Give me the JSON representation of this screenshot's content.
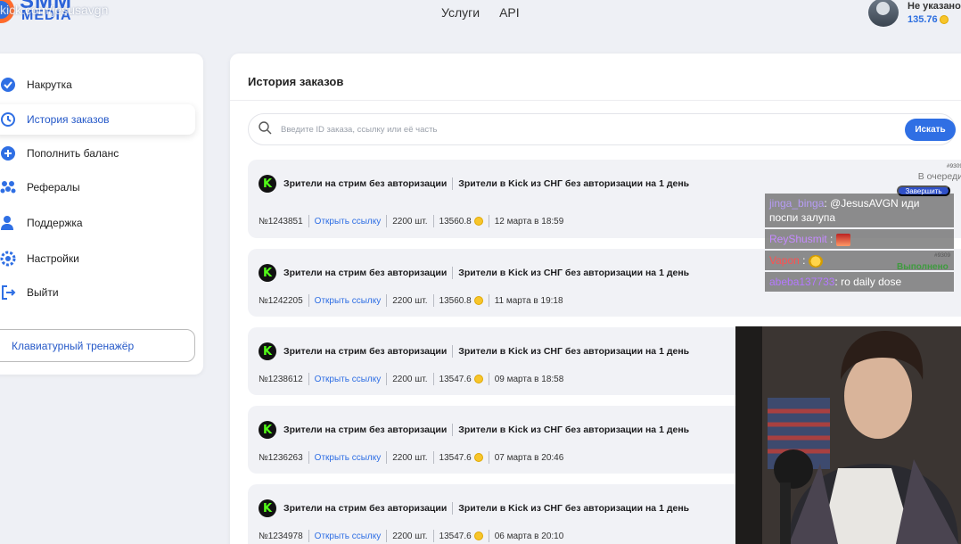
{
  "stream_overlay_title": "kick.com/jesusavgn",
  "brand": {
    "line1": "SMM",
    "line2": "MEDIA"
  },
  "topnav": [
    {
      "label": "Услуги"
    },
    {
      "label": "API"
    }
  ],
  "user": {
    "name": "Не указано",
    "balance": "135.76"
  },
  "sidebar": {
    "items": [
      {
        "label": "Накрутка",
        "icon": "check-badge-icon"
      },
      {
        "label": "История заказов",
        "icon": "history-icon",
        "active": true
      },
      {
        "label": "Пополнить баланс",
        "icon": "plus-circle-icon"
      },
      {
        "label": "Рефералы",
        "icon": "group-icon"
      },
      {
        "label": "Поддержка",
        "icon": "support-icon"
      },
      {
        "label": "Настройки",
        "icon": "gear-icon"
      },
      {
        "label": "Выйти",
        "icon": "logout-icon"
      }
    ],
    "trainer_label": "Клавиатурный тренажёр"
  },
  "main": {
    "title": "История заказов",
    "search": {
      "placeholder": "Введите ID заказа, ссылку или её часть",
      "button": "Искать"
    },
    "orders": [
      {
        "service": "Зрители на стрим без авторизации",
        "detail": "Зрители в Kick из СНГ без авторизации на 1 день",
        "id": "№1243851",
        "link": "Открыть ссылку",
        "qty": "2200 шт.",
        "price": "13560.8",
        "date": "12 марта в 18:59",
        "num": "#9309",
        "status": "В очереди"
      },
      {
        "service": "Зрители на стрим без авторизации",
        "detail": "Зрители в Kick из СНГ без авторизации на 1 день",
        "id": "№1242205",
        "link": "Открыть ссылку",
        "qty": "2200 шт.",
        "price": "13560.8",
        "date": "11 марта в 19:18"
      },
      {
        "service": "Зрители на стрим без авторизации",
        "detail": "Зрители в Kick из СНГ без авторизации на 1 день",
        "id": "№1238612",
        "link": "Открыть ссылку",
        "qty": "2200 шт.",
        "price": "13547.6",
        "date": "09 марта в 18:58"
      },
      {
        "service": "Зрители на стрим без авторизации",
        "detail": "Зрители в Kick из СНГ без авторизации на 1 день",
        "id": "№1236263",
        "link": "Открыть ссылку",
        "qty": "2200 шт.",
        "price": "13547.6",
        "date": "07 марта в 20:46"
      },
      {
        "service": "Зрители на стрим без авторизации",
        "detail": "Зрители в Kick из СНГ без авторизации на 1 день",
        "id": "№1234978",
        "link": "Открыть ссылку",
        "qty": "2200 шт.",
        "price": "13547.6",
        "date": "06 марта в 20:10"
      }
    ]
  },
  "overlay": {
    "end_button": "Завершить",
    "second_num": "#9309",
    "done_status": "Выполнено",
    "chat": [
      {
        "user": "jinga_binga",
        "text": ": @JesusAVGN иди поспи залупа"
      },
      {
        "user": "ReyShusmit",
        "text": " :"
      },
      {
        "user": "Vapon",
        "text": " :"
      },
      {
        "user": "abeba137733",
        "text": ": ro daily dose"
      }
    ]
  },
  "colors": {
    "accent": "#2f6fe4",
    "kick_green": "#53fc18",
    "done_green": "#3f9b3f"
  }
}
